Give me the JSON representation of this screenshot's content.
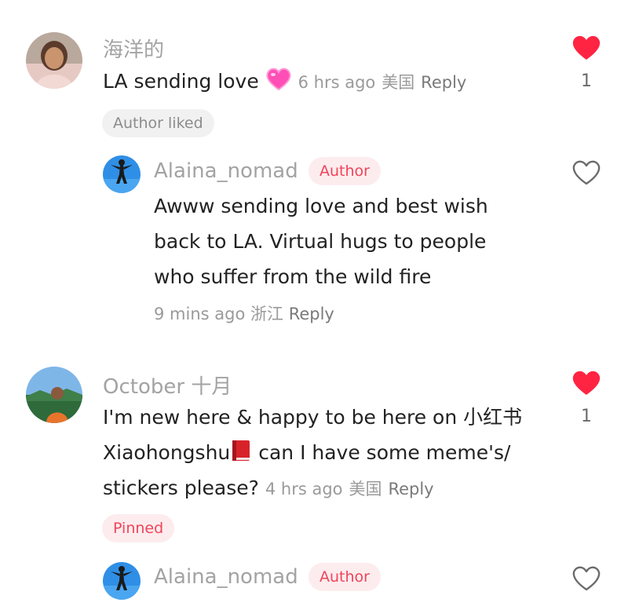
{
  "colors": {
    "liked_heart": "#ff2442",
    "author_tag_text": "#f0445a",
    "author_tag_bg": "#fdecee",
    "meta_text": "#9a9a9a"
  },
  "comments": [
    {
      "username": "海洋的",
      "text_before_emoji": "LA sending love",
      "emoji": "pink-heart-emoji",
      "time": "6 hrs ago",
      "location": "美国",
      "reply_label": "Reply",
      "liked": true,
      "like_count": "1",
      "badge": "Author liked",
      "reply": {
        "username": "Alaina_nomad",
        "author_tag": "Author",
        "lines": [
          "Awww sending love and best wish",
          "back to LA. Virtual hugs to people",
          "who suffer from the wild fire"
        ],
        "time": "9 mins ago",
        "location": "浙江",
        "reply_label": "Reply",
        "liked": false
      }
    },
    {
      "username": "October 十月",
      "line1": "I'm new here & happy to be here on 小红书",
      "line2_before_emoji": "Xiaohongshu",
      "emoji": "red-book-emoji",
      "line2_after_emoji": " can I have some meme's/",
      "line3": "stickers please?",
      "time": "4 hrs ago",
      "location": "美国",
      "reply_label": "Reply",
      "liked": true,
      "like_count": "1",
      "badge": "Pinned",
      "reply": {
        "username": "Alaina_nomad",
        "author_tag": "Author",
        "liked": false
      }
    }
  ]
}
